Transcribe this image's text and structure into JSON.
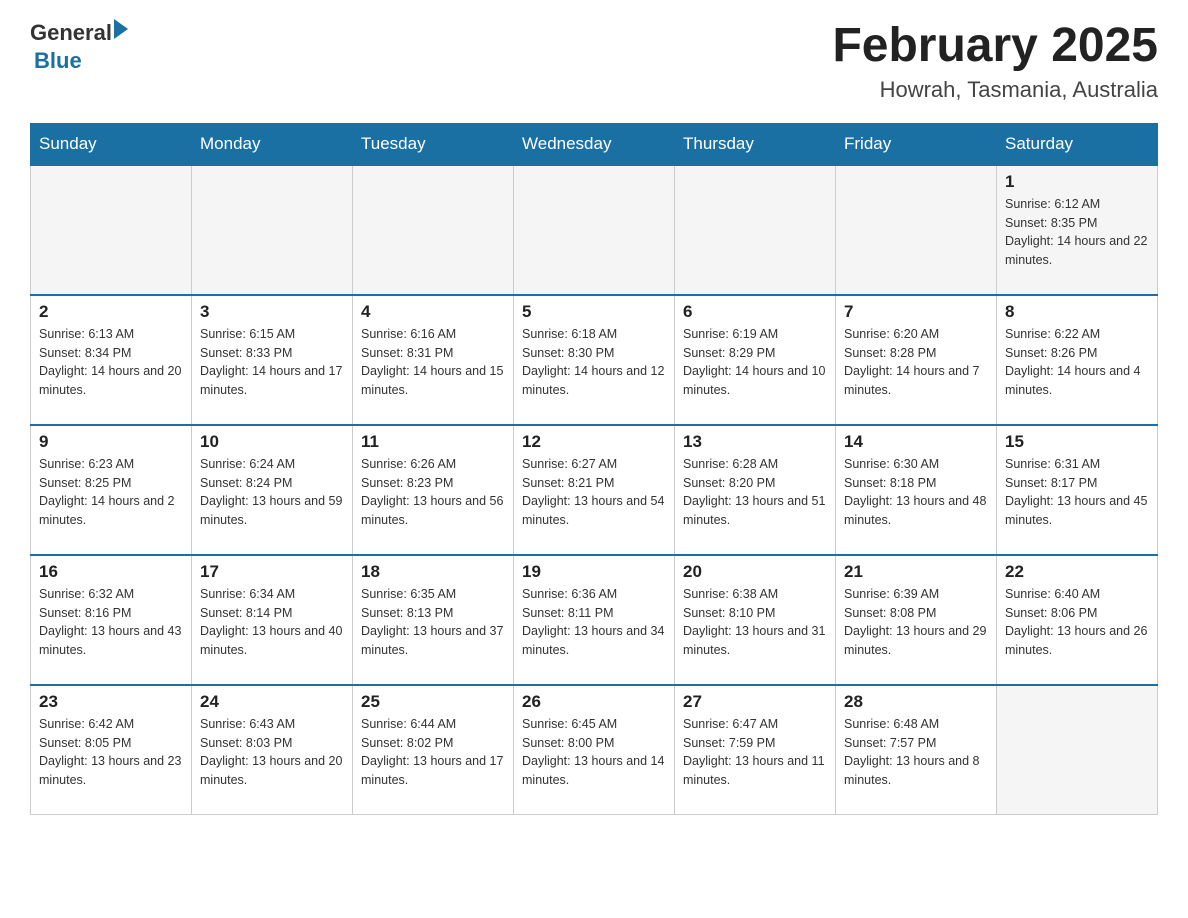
{
  "header": {
    "logo_general": "General",
    "logo_blue": "Blue",
    "month_title": "February 2025",
    "location": "Howrah, Tasmania, Australia"
  },
  "days_of_week": [
    "Sunday",
    "Monday",
    "Tuesday",
    "Wednesday",
    "Thursday",
    "Friday",
    "Saturday"
  ],
  "weeks": [
    [
      {
        "day": "",
        "sunrise": "",
        "sunset": "",
        "daylight": ""
      },
      {
        "day": "",
        "sunrise": "",
        "sunset": "",
        "daylight": ""
      },
      {
        "day": "",
        "sunrise": "",
        "sunset": "",
        "daylight": ""
      },
      {
        "day": "",
        "sunrise": "",
        "sunset": "",
        "daylight": ""
      },
      {
        "day": "",
        "sunrise": "",
        "sunset": "",
        "daylight": ""
      },
      {
        "day": "",
        "sunrise": "",
        "sunset": "",
        "daylight": ""
      },
      {
        "day": "1",
        "sunrise": "Sunrise: 6:12 AM",
        "sunset": "Sunset: 8:35 PM",
        "daylight": "Daylight: 14 hours and 22 minutes."
      }
    ],
    [
      {
        "day": "2",
        "sunrise": "Sunrise: 6:13 AM",
        "sunset": "Sunset: 8:34 PM",
        "daylight": "Daylight: 14 hours and 20 minutes."
      },
      {
        "day": "3",
        "sunrise": "Sunrise: 6:15 AM",
        "sunset": "Sunset: 8:33 PM",
        "daylight": "Daylight: 14 hours and 17 minutes."
      },
      {
        "day": "4",
        "sunrise": "Sunrise: 6:16 AM",
        "sunset": "Sunset: 8:31 PM",
        "daylight": "Daylight: 14 hours and 15 minutes."
      },
      {
        "day": "5",
        "sunrise": "Sunrise: 6:18 AM",
        "sunset": "Sunset: 8:30 PM",
        "daylight": "Daylight: 14 hours and 12 minutes."
      },
      {
        "day": "6",
        "sunrise": "Sunrise: 6:19 AM",
        "sunset": "Sunset: 8:29 PM",
        "daylight": "Daylight: 14 hours and 10 minutes."
      },
      {
        "day": "7",
        "sunrise": "Sunrise: 6:20 AM",
        "sunset": "Sunset: 8:28 PM",
        "daylight": "Daylight: 14 hours and 7 minutes."
      },
      {
        "day": "8",
        "sunrise": "Sunrise: 6:22 AM",
        "sunset": "Sunset: 8:26 PM",
        "daylight": "Daylight: 14 hours and 4 minutes."
      }
    ],
    [
      {
        "day": "9",
        "sunrise": "Sunrise: 6:23 AM",
        "sunset": "Sunset: 8:25 PM",
        "daylight": "Daylight: 14 hours and 2 minutes."
      },
      {
        "day": "10",
        "sunrise": "Sunrise: 6:24 AM",
        "sunset": "Sunset: 8:24 PM",
        "daylight": "Daylight: 13 hours and 59 minutes."
      },
      {
        "day": "11",
        "sunrise": "Sunrise: 6:26 AM",
        "sunset": "Sunset: 8:23 PM",
        "daylight": "Daylight: 13 hours and 56 minutes."
      },
      {
        "day": "12",
        "sunrise": "Sunrise: 6:27 AM",
        "sunset": "Sunset: 8:21 PM",
        "daylight": "Daylight: 13 hours and 54 minutes."
      },
      {
        "day": "13",
        "sunrise": "Sunrise: 6:28 AM",
        "sunset": "Sunset: 8:20 PM",
        "daylight": "Daylight: 13 hours and 51 minutes."
      },
      {
        "day": "14",
        "sunrise": "Sunrise: 6:30 AM",
        "sunset": "Sunset: 8:18 PM",
        "daylight": "Daylight: 13 hours and 48 minutes."
      },
      {
        "day": "15",
        "sunrise": "Sunrise: 6:31 AM",
        "sunset": "Sunset: 8:17 PM",
        "daylight": "Daylight: 13 hours and 45 minutes."
      }
    ],
    [
      {
        "day": "16",
        "sunrise": "Sunrise: 6:32 AM",
        "sunset": "Sunset: 8:16 PM",
        "daylight": "Daylight: 13 hours and 43 minutes."
      },
      {
        "day": "17",
        "sunrise": "Sunrise: 6:34 AM",
        "sunset": "Sunset: 8:14 PM",
        "daylight": "Daylight: 13 hours and 40 minutes."
      },
      {
        "day": "18",
        "sunrise": "Sunrise: 6:35 AM",
        "sunset": "Sunset: 8:13 PM",
        "daylight": "Daylight: 13 hours and 37 minutes."
      },
      {
        "day": "19",
        "sunrise": "Sunrise: 6:36 AM",
        "sunset": "Sunset: 8:11 PM",
        "daylight": "Daylight: 13 hours and 34 minutes."
      },
      {
        "day": "20",
        "sunrise": "Sunrise: 6:38 AM",
        "sunset": "Sunset: 8:10 PM",
        "daylight": "Daylight: 13 hours and 31 minutes."
      },
      {
        "day": "21",
        "sunrise": "Sunrise: 6:39 AM",
        "sunset": "Sunset: 8:08 PM",
        "daylight": "Daylight: 13 hours and 29 minutes."
      },
      {
        "day": "22",
        "sunrise": "Sunrise: 6:40 AM",
        "sunset": "Sunset: 8:06 PM",
        "daylight": "Daylight: 13 hours and 26 minutes."
      }
    ],
    [
      {
        "day": "23",
        "sunrise": "Sunrise: 6:42 AM",
        "sunset": "Sunset: 8:05 PM",
        "daylight": "Daylight: 13 hours and 23 minutes."
      },
      {
        "day": "24",
        "sunrise": "Sunrise: 6:43 AM",
        "sunset": "Sunset: 8:03 PM",
        "daylight": "Daylight: 13 hours and 20 minutes."
      },
      {
        "day": "25",
        "sunrise": "Sunrise: 6:44 AM",
        "sunset": "Sunset: 8:02 PM",
        "daylight": "Daylight: 13 hours and 17 minutes."
      },
      {
        "day": "26",
        "sunrise": "Sunrise: 6:45 AM",
        "sunset": "Sunset: 8:00 PM",
        "daylight": "Daylight: 13 hours and 14 minutes."
      },
      {
        "day": "27",
        "sunrise": "Sunrise: 6:47 AM",
        "sunset": "Sunset: 7:59 PM",
        "daylight": "Daylight: 13 hours and 11 minutes."
      },
      {
        "day": "28",
        "sunrise": "Sunrise: 6:48 AM",
        "sunset": "Sunset: 7:57 PM",
        "daylight": "Daylight: 13 hours and 8 minutes."
      },
      {
        "day": "",
        "sunrise": "",
        "sunset": "",
        "daylight": ""
      }
    ]
  ]
}
